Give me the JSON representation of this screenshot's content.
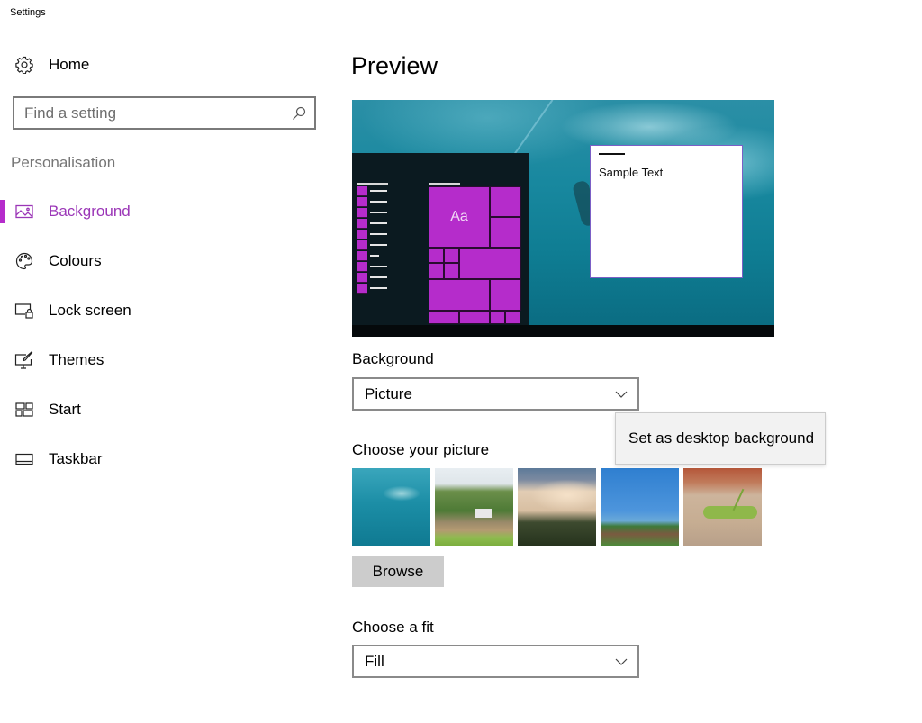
{
  "app": {
    "title": "Settings"
  },
  "sidebar": {
    "home_label": "Home",
    "home_icon": "gear-icon",
    "search": {
      "placeholder": "Find a setting",
      "value": "",
      "icon": "search-icon"
    },
    "section_label": "Personalisation",
    "items": [
      {
        "label": "Background",
        "icon": "picture-icon",
        "active": true
      },
      {
        "label": "Colours",
        "icon": "palette-icon",
        "active": false
      },
      {
        "label": "Lock screen",
        "icon": "lock-screen-icon",
        "active": false
      },
      {
        "label": "Themes",
        "icon": "themes-icon",
        "active": false
      },
      {
        "label": "Start",
        "icon": "start-icon",
        "active": false
      },
      {
        "label": "Taskbar",
        "icon": "taskbar-icon",
        "active": false
      }
    ]
  },
  "main": {
    "title": "Preview",
    "preview": {
      "tile_label": "Aa",
      "sample_text": "Sample Text"
    },
    "background": {
      "label": "Background",
      "value": "Picture"
    },
    "context_menu": {
      "items": [
        "Set as desktop background"
      ]
    },
    "choose_picture": {
      "label": "Choose your picture",
      "thumbnails": [
        "underwater swimmer",
        "farm with trailer",
        "clouds over trees",
        "blue sky with village",
        "grasshopper"
      ]
    },
    "browse_label": "Browse",
    "fit": {
      "label": "Choose a fit",
      "value": "Fill"
    }
  },
  "colors": {
    "accent": "#b52ccb",
    "accent_text": "#9b36b7"
  }
}
